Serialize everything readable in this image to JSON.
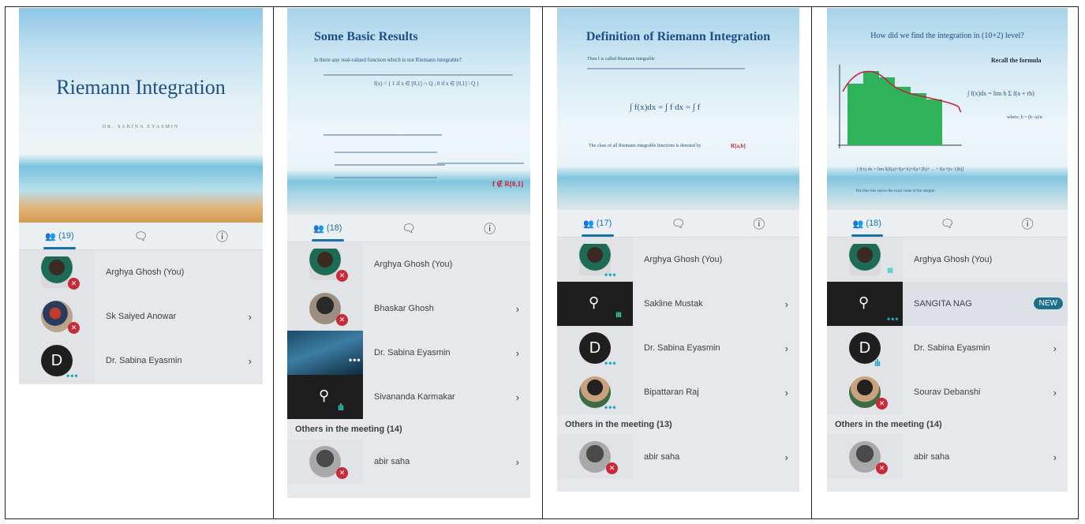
{
  "panels": [
    {
      "slide": {
        "title": "Riemann Integration",
        "subtitle": "DR. SABINA EYASMIN"
      },
      "tabs": {
        "people_count": "(19)"
      },
      "participants": [
        {
          "name": "Arghya Ghosh (You)"
        },
        {
          "name": "Sk Saiyed Anowar"
        },
        {
          "name": "Dr. Sabina Eyasmin",
          "initial": "D"
        }
      ]
    },
    {
      "slide": {
        "title": "Some Basic Results",
        "line1": "Is there any real-valued function which is not Riemann integrable?",
        "formula": "f(x) = { 1 if x ∈ [0,1] ∩ Q ; 0 if x ∈ [0,1] \\ Q }",
        "red_note": "f ∉ R[0,1]"
      },
      "tabs": {
        "people_count": "(18)"
      },
      "participants": [
        {
          "name": "Arghya Ghosh (You)"
        },
        {
          "name": "Bhaskar Ghosh"
        },
        {
          "name": "Dr. Sabina Eyasmin"
        },
        {
          "name": "Sivananda Karmakar"
        }
      ],
      "others_label": "Others in the meeting (14)",
      "others": [
        {
          "name": "abir saha"
        }
      ]
    },
    {
      "slide": {
        "title": "Definition of Riemann Integration",
        "line1": "Then f is called Riemann integrable",
        "formula": "∫ f(x)dx  =  ∫ f dx  =  ∫ f",
        "line2": "The class of all Riemann integrable functions is denoted by",
        "red_note": "R[a,b]"
      },
      "tabs": {
        "people_count": "(17)"
      },
      "participants": [
        {
          "name": "Arghya Ghosh (You)"
        },
        {
          "name": "Sakline Mustak"
        },
        {
          "name": "Dr. Sabina Eyasmin",
          "initial": "D"
        },
        {
          "name": "Bipattaran Raj"
        }
      ],
      "others_label": "Others in the meeting (13)",
      "others": [
        {
          "name": "abir saha"
        }
      ]
    },
    {
      "slide": {
        "title": "How did we find the integration in (10+2) level?",
        "recall": "Recall the formula",
        "formula": "∫ f(x)dx = lim h Σ f(a + rh)",
        "where": "where, h = (b−a)/n",
        "bottom_formula": "∫ f(x) dx = lim h[f(a)+f(a+h)+f(a+2h)+ ... + f(a+(n−1)h)]",
        "bottom_note": "The blue line shows the exact value of the integral"
      },
      "tabs": {
        "people_count": "(18)"
      },
      "participants": [
        {
          "name": "Arghya Ghosh (You)"
        },
        {
          "name": "SANGITA NAG",
          "badge": "NEW"
        },
        {
          "name": "Dr. Sabina Eyasmin",
          "initial": "D"
        },
        {
          "name": "Sourav Debanshi"
        }
      ],
      "others_label": "Others in the meeting (14)",
      "others": [
        {
          "name": "abir saha"
        }
      ]
    }
  ],
  "icons": {
    "people": "people-icon",
    "chat": "chat-icon",
    "info": "info-icon",
    "mic_off": "mic-off-icon",
    "pin": "pin-icon",
    "chevron": "chevron-right-icon"
  },
  "colors": {
    "accent": "#1a73a8",
    "muted_red": "#c62b3a",
    "chart_green": "#2fb35a"
  }
}
